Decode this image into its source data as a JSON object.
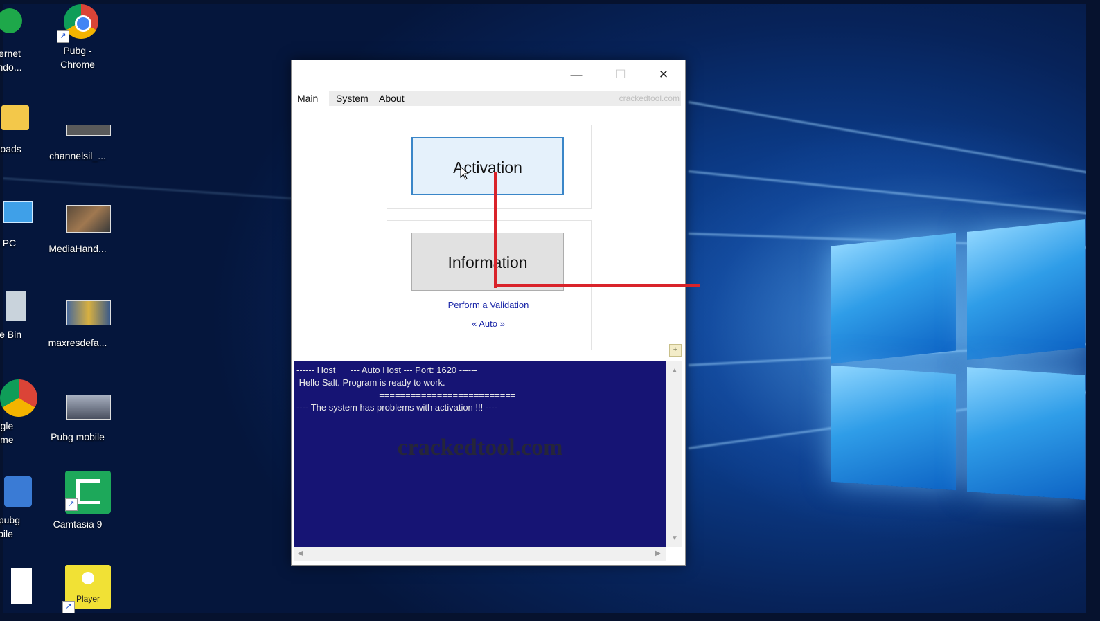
{
  "desktop": {
    "icons": [
      {
        "label_line1": "ernet",
        "label_line2": "ndo..."
      },
      {
        "label_line1": "Pubg -",
        "label_line2": "Chrome"
      },
      {
        "label_line1": "loads",
        "label_line2": ""
      },
      {
        "label_line1": "channelsil_...",
        "label_line2": ""
      },
      {
        "label_line1": "s PC",
        "label_line2": ""
      },
      {
        "label_line1": "MediaHand...",
        "label_line2": ""
      },
      {
        "label_line1": "cle Bin",
        "label_line2": ""
      },
      {
        "label_line1": "maxresdefa...",
        "label_line2": ""
      },
      {
        "label_line1": "ogle",
        "label_line2": "ome"
      },
      {
        "label_line1": "Pubg mobile",
        "label_line2": ""
      },
      {
        "label_line1": "s pubg",
        "label_line2": "bile"
      },
      {
        "label_line1": "Camtasia 9",
        "label_line2": ""
      },
      {
        "label_line1": "Player",
        "label_line2": ""
      }
    ]
  },
  "window": {
    "controls": {
      "minimize": "—",
      "maximize": "☐",
      "close": "✕"
    },
    "tabs": [
      "Main",
      "System",
      "About"
    ],
    "site_label": "crackedtool.com",
    "activation_button": "Activation",
    "information_button": "Information",
    "validation_link": "Perform a Validation",
    "auto_link": "« Auto »",
    "console": {
      "lines": [
        "------ Host      --- Auto Host --- Port: 1620 ------",
        " Hello Salt. Program is ready to work.",
        "                                 ==========================",
        "---- The system has problems with activation !!! ----"
      ],
      "watermark": "crackedtool.com"
    }
  },
  "colors": {
    "callout": "#d9232a",
    "console_bg": "#161474"
  }
}
